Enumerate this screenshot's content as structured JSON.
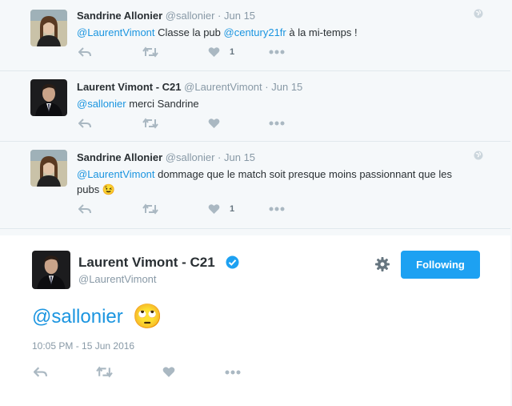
{
  "thread": [
    {
      "name": "Sandrine Allonier",
      "handle": "@sallonier",
      "separator": "·",
      "date": "Jun 15",
      "mention1": "@LaurentVimont",
      "text1": " Classe la pub ",
      "mention2": "@century21fr",
      "text2": " à la mi-temps !",
      "like_count": "1",
      "avatar": "woman-portrait"
    },
    {
      "name": "Laurent Vimont - C21",
      "handle": "@LaurentVimont",
      "separator": "·",
      "date": "Jun 15",
      "mention1": "@sallonier",
      "text1": " merci Sandrine",
      "avatar": "man-portrait"
    },
    {
      "name": "Sandrine Allonier",
      "handle": "@sallonier",
      "separator": "·",
      "date": "Jun 15",
      "mention1": "@LaurentVimont",
      "text1": " dommage que le match soit presque moins passionnant que les pubs ",
      "emoji": "😉",
      "like_count": "1",
      "avatar": "woman-portrait"
    }
  ],
  "focus": {
    "name": "Laurent Vimont - C21",
    "handle": "@LaurentVimont",
    "follow_label": "Following",
    "mention": "@sallonier",
    "emoji": "🙄",
    "timestamp": "10:05 PM - 15 Jun 2016"
  },
  "colors": {
    "accent": "#1da1f2",
    "link": "#1b95e0",
    "muted": "#8899a6",
    "icon": "#aab8c2"
  }
}
